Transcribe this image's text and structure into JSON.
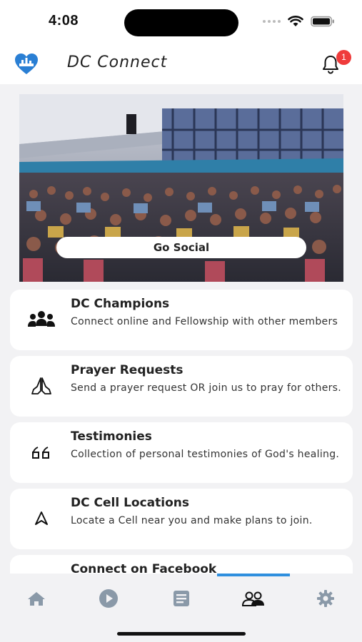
{
  "status_bar": {
    "time": "4:08"
  },
  "header": {
    "title": "DC Connect",
    "notification_count": "1"
  },
  "hero": {
    "button_label": "Go Social"
  },
  "cards": [
    {
      "title": "DC Champions",
      "description": "Connect online and Fellowship with other members",
      "icon": "group-icon"
    },
    {
      "title": "Prayer Requests",
      "description": "Send a prayer request OR join us to pray for others.",
      "icon": "praying-hands-icon"
    },
    {
      "title": "Testimonies",
      "description": "Collection of personal testimonies of God's healing.",
      "icon": "quote-icon"
    },
    {
      "title": "DC Cell Locations",
      "description": "Locate a Cell near you and make plans to join.",
      "icon": "location-arrow-icon"
    },
    {
      "title": "Connect on Facebook",
      "description": "",
      "icon": "facebook-icon"
    }
  ],
  "tab_bar": {
    "tabs": [
      {
        "name": "home",
        "icon": "home-icon",
        "active": false
      },
      {
        "name": "media",
        "icon": "play-icon",
        "active": false
      },
      {
        "name": "notes",
        "icon": "document-icon",
        "active": false
      },
      {
        "name": "connect",
        "icon": "people-icon",
        "active": true
      },
      {
        "name": "settings",
        "icon": "gear-icon",
        "active": false
      }
    ]
  },
  "colors": {
    "accent": "#2f8fde",
    "badge": "#ef3b3b",
    "logo": "#2a7fd4",
    "inactive_icon": "#8a99a8"
  }
}
